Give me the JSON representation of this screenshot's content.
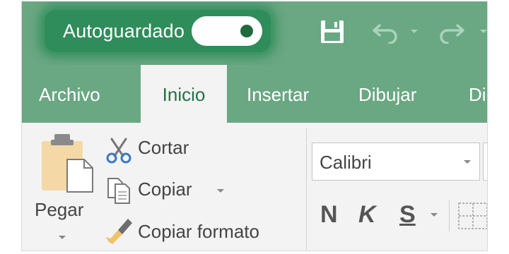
{
  "titlebar": {
    "autosave_label": "Autoguardado",
    "autosave_state": "on"
  },
  "tabs": [
    {
      "label": "Archivo"
    },
    {
      "label": "Inicio"
    },
    {
      "label": "Insertar"
    },
    {
      "label": "Dibujar"
    },
    {
      "label": "Di"
    }
  ],
  "clipboard": {
    "paste_label": "Pegar",
    "cut_label": "Cortar",
    "copy_label": "Copiar",
    "format_painter_label": "Copiar formato"
  },
  "font": {
    "font_name": "Calibri",
    "bold_label": "N",
    "italic_label": "K",
    "underline_label": "S"
  },
  "icons": {
    "save": "save-icon",
    "undo": "undo-icon",
    "redo": "redo-icon",
    "cut": "scissors-icon",
    "copy": "copy-icon",
    "paste": "clipboard-icon",
    "format_painter": "paintbrush-icon",
    "borders": "borders-icon"
  },
  "colors": {
    "excel_green": "#217346",
    "titlebar_green": "#6aa783",
    "autosave_glow": "#2f8d5b",
    "ribbon_background": "#f3f3f3"
  }
}
